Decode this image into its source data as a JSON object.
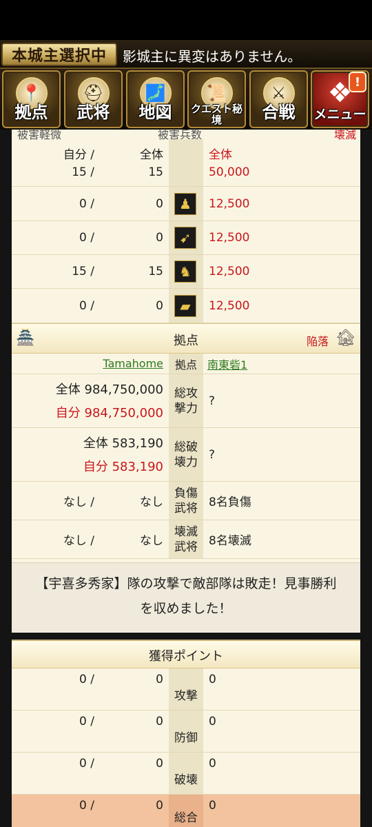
{
  "header": {
    "castle_badge": "本城主選択中",
    "castle_message": "影城主に異変はありません。"
  },
  "nav": {
    "items": [
      {
        "label": "拠点",
        "icon": "map-pin-icon",
        "glyph": "📍"
      },
      {
        "label": "武将",
        "icon": "helmet-icon",
        "glyph": "⛑"
      },
      {
        "label": "地図",
        "icon": "map-icon",
        "glyph": "🗾"
      },
      {
        "label": "クエスト秘境",
        "icon": "scroll-icon",
        "glyph": "📜"
      },
      {
        "label": "合戦",
        "icon": "crossed-swords-icon",
        "glyph": "⚔"
      },
      {
        "label": "メニュー",
        "icon": "menu-grid-icon",
        "glyph": "❖"
      }
    ],
    "notification_badge": "!"
  },
  "damage": {
    "cut_left": "被害軽微",
    "cut_center": "被害兵数",
    "cut_right": "壊滅",
    "header_self": "自分 /",
    "header_total": "全体",
    "header_enemy_total": "全体",
    "summary": {
      "self": "15 /",
      "total": "15",
      "enemy": "50,000"
    },
    "units": [
      {
        "self": "0 /",
        "total": "0",
        "icon": "spearman-icon",
        "glyph": "♟",
        "enemy": "12,500"
      },
      {
        "self": "0 /",
        "total": "0",
        "icon": "bow-icon",
        "glyph": "➹",
        "enemy": "12,500"
      },
      {
        "self": "15 /",
        "total": "15",
        "icon": "horse-icon",
        "glyph": "♞",
        "enemy": "12,500"
      },
      {
        "self": "0 /",
        "total": "0",
        "icon": "cannon-icon",
        "glyph": "▰",
        "enemy": "12,500"
      }
    ]
  },
  "base": {
    "title": "拠点",
    "fallen_label": "陥落",
    "attacker": "Tamahome",
    "base_label": "拠点",
    "base_name": "南東砦1",
    "attack": {
      "total": "全体 984,750,000",
      "self": "自分 984,750,000",
      "label": "総攻\n撃力",
      "enemy": "?"
    },
    "destroy": {
      "total": "全体 583,190",
      "self": "自分 583,190",
      "label": "総破\n壊力",
      "enemy": "?"
    },
    "injured": {
      "self": "なし /",
      "total": "なし",
      "label": "負傷\n武将",
      "enemy": "8名負傷"
    },
    "destroyed": {
      "self": "なし /",
      "total": "なし",
      "label": "壊滅\n武将",
      "enemy": "8名壊滅"
    },
    "result_line1": "【宇喜多秀家】隊の攻撃で敵部隊は敗走！見事勝利",
    "result_line2": "を収めました！"
  },
  "points": {
    "title": "獲得ポイント",
    "rows": [
      {
        "self": "0 /",
        "total": "0",
        "label": "攻撃",
        "enemy": "0"
      },
      {
        "self": "0 /",
        "total": "0",
        "label": "防御",
        "enemy": "0"
      },
      {
        "self": "0 /",
        "total": "0",
        "label": "破壊",
        "enemy": "0"
      },
      {
        "self": "0 /",
        "total": "0",
        "label": "総合",
        "enemy": "0"
      }
    ]
  }
}
